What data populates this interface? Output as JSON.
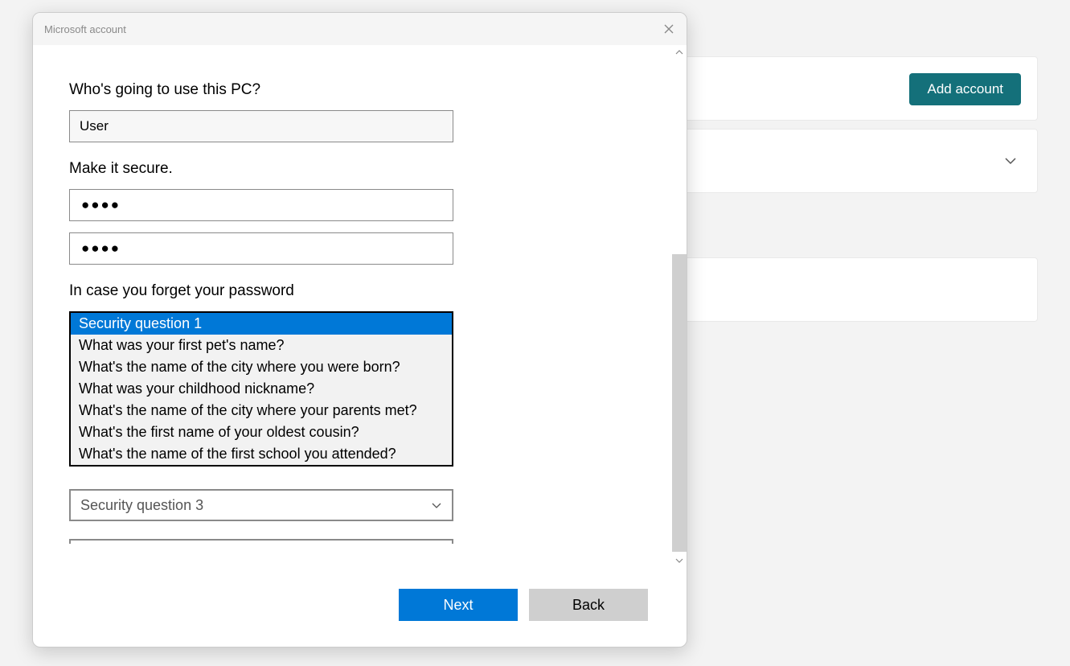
{
  "background": {
    "add_account_label": "Add account"
  },
  "dialog": {
    "title": "Microsoft account",
    "heading_user": "Who's going to use this PC?",
    "username_value": "User",
    "heading_secure": "Make it secure.",
    "password_mask": "●●●●",
    "confirm_mask": "●●●●",
    "heading_forget": "In case you forget your password",
    "dropdown_open": {
      "selected": "Security question 1",
      "options": [
        "What was your first pet's name?",
        "What's the name of the city where you were born?",
        "What was your childhood nickname?",
        "What's the name of the city where your parents met?",
        "What's the first name of your oldest cousin?",
        "What's the name of the first school you attended?"
      ]
    },
    "select3_label": "Security question 3",
    "next_label": "Next",
    "back_label": "Back"
  }
}
